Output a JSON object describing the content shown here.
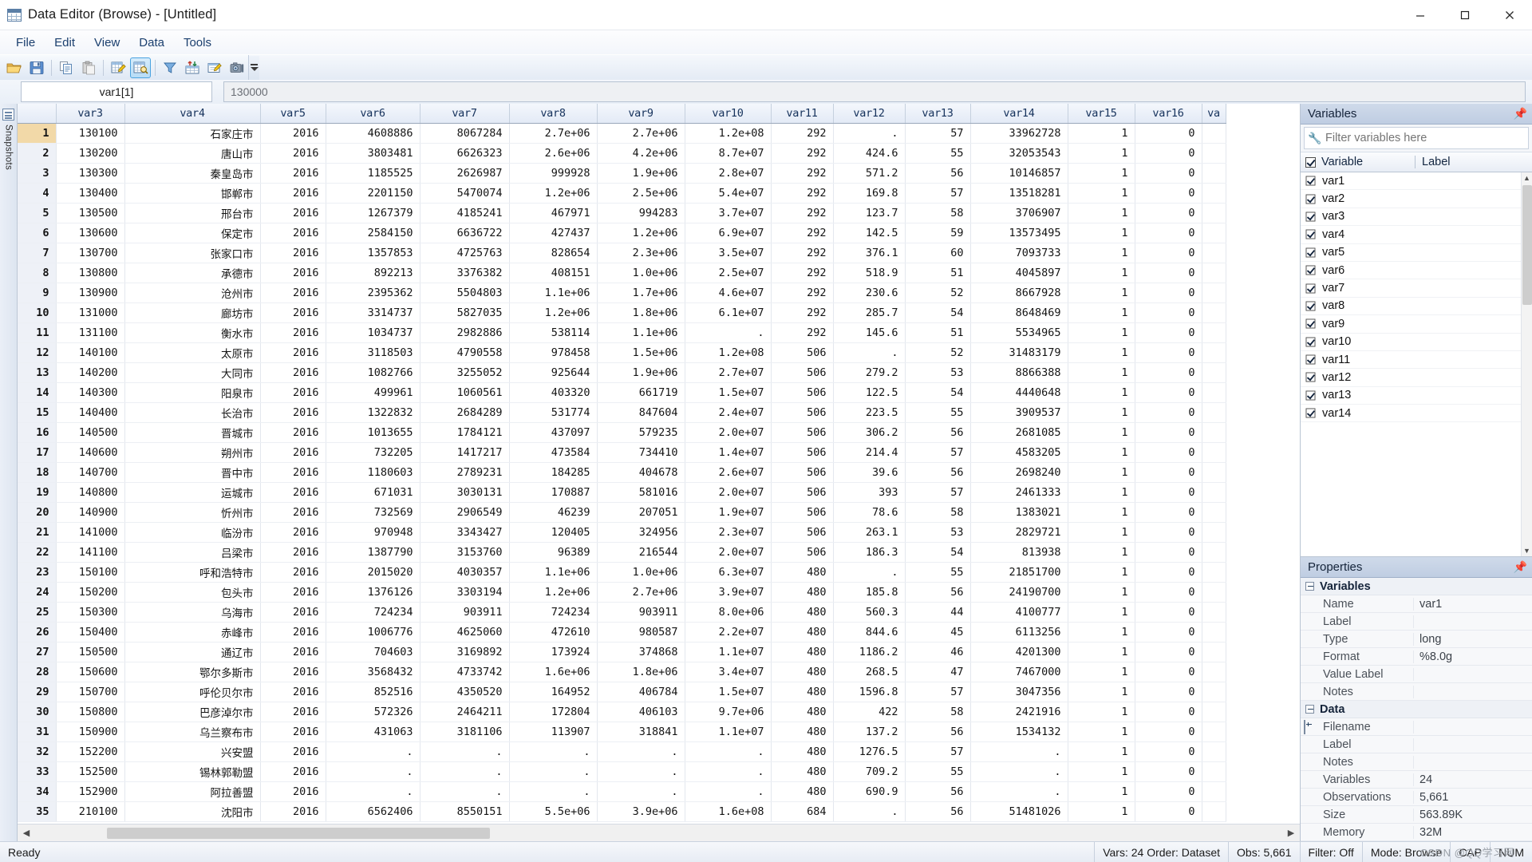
{
  "window": {
    "title": "Data Editor (Browse) - [Untitled]",
    "app_icon": "grid-icon",
    "minimize": "–",
    "maximize": "❐",
    "close": "✕"
  },
  "menubar": {
    "items": [
      "File",
      "Edit",
      "View",
      "Data",
      "Tools"
    ]
  },
  "toolbar": {
    "buttons": [
      {
        "name": "open-file-button",
        "icon": "folder-open-icon",
        "active": false
      },
      {
        "name": "save-button",
        "icon": "floppy-disk-icon",
        "active": false
      },
      {
        "name": "copy-button",
        "icon": "copy-icon",
        "active": false
      },
      {
        "name": "paste-button",
        "icon": "paste-icon",
        "active": false
      },
      {
        "name": "data-edit-button",
        "icon": "pencil-grid-icon",
        "active": false
      },
      {
        "name": "data-browse-button",
        "icon": "magnifier-grid-icon",
        "active": true
      },
      {
        "name": "filter-button",
        "icon": "funnel-icon",
        "active": false
      },
      {
        "name": "variables-manager-button",
        "icon": "arrows-grid-icon",
        "active": false
      },
      {
        "name": "variables-properties-button",
        "icon": "properties-icon",
        "active": false
      },
      {
        "name": "snapshot-button",
        "icon": "camera-icon",
        "active": false
      }
    ],
    "overflow_label": "▼"
  },
  "formula_bar": {
    "cell_reference": "var1[1]",
    "cell_value": "130000"
  },
  "snapshots_rail": {
    "label": "Snapshots",
    "icon": "snapshot-panel-icon"
  },
  "grid": {
    "columns": [
      "var3",
      "var4",
      "var5",
      "var6",
      "var7",
      "var8",
      "var9",
      "var10",
      "var11",
      "var12",
      "var13",
      "var14",
      "var15",
      "var16",
      "va"
    ],
    "selected_row": 1,
    "rows": [
      {
        "n": 1,
        "c": [
          "130100",
          "石家庄市",
          "2016",
          "4608886",
          "8067284",
          "2.7e+06",
          "2.7e+06",
          "1.2e+08",
          "292",
          ".",
          "57",
          "33962728",
          "1",
          "0",
          ""
        ]
      },
      {
        "n": 2,
        "c": [
          "130200",
          "唐山市",
          "2016",
          "3803481",
          "6626323",
          "2.6e+06",
          "4.2e+06",
          "8.7e+07",
          "292",
          "424.6",
          "55",
          "32053543",
          "1",
          "0",
          ""
        ]
      },
      {
        "n": 3,
        "c": [
          "130300",
          "秦皇岛市",
          "2016",
          "1185525",
          "2626987",
          "999928",
          "1.9e+06",
          "2.8e+07",
          "292",
          "571.2",
          "56",
          "10146857",
          "1",
          "0",
          ""
        ]
      },
      {
        "n": 4,
        "c": [
          "130400",
          "邯郸市",
          "2016",
          "2201150",
          "5470074",
          "1.2e+06",
          "2.5e+06",
          "5.4e+07",
          "292",
          "169.8",
          "57",
          "13518281",
          "1",
          "0",
          ""
        ]
      },
      {
        "n": 5,
        "c": [
          "130500",
          "邢台市",
          "2016",
          "1267379",
          "4185241",
          "467971",
          "994283",
          "3.7e+07",
          "292",
          "123.7",
          "58",
          "3706907",
          "1",
          "0",
          ""
        ]
      },
      {
        "n": 6,
        "c": [
          "130600",
          "保定市",
          "2016",
          "2584150",
          "6636722",
          "427437",
          "1.2e+06",
          "6.9e+07",
          "292",
          "142.5",
          "59",
          "13573495",
          "1",
          "0",
          ""
        ]
      },
      {
        "n": 7,
        "c": [
          "130700",
          "张家口市",
          "2016",
          "1357853",
          "4725763",
          "828654",
          "2.3e+06",
          "3.5e+07",
          "292",
          "376.1",
          "60",
          "7093733",
          "1",
          "0",
          ""
        ]
      },
      {
        "n": 8,
        "c": [
          "130800",
          "承德市",
          "2016",
          "892213",
          "3376382",
          "408151",
          "1.0e+06",
          "2.5e+07",
          "292",
          "518.9",
          "51",
          "4045897",
          "1",
          "0",
          ""
        ]
      },
      {
        "n": 9,
        "c": [
          "130900",
          "沧州市",
          "2016",
          "2395362",
          "5504803",
          "1.1e+06",
          "1.7e+06",
          "4.6e+07",
          "292",
          "230.6",
          "52",
          "8667928",
          "1",
          "0",
          ""
        ]
      },
      {
        "n": 10,
        "c": [
          "131000",
          "廊坊市",
          "2016",
          "3314737",
          "5827035",
          "1.2e+06",
          "1.8e+06",
          "6.1e+07",
          "292",
          "285.7",
          "54",
          "8648469",
          "1",
          "0",
          ""
        ]
      },
      {
        "n": 11,
        "c": [
          "131100",
          "衡水市",
          "2016",
          "1034737",
          "2982886",
          "538114",
          "1.1e+06",
          ".",
          "292",
          "145.6",
          "51",
          "5534965",
          "1",
          "0",
          ""
        ]
      },
      {
        "n": 12,
        "c": [
          "140100",
          "太原市",
          "2016",
          "3118503",
          "4790558",
          "978458",
          "1.5e+06",
          "1.2e+08",
          "506",
          ".",
          "52",
          "31483179",
          "1",
          "0",
          ""
        ]
      },
      {
        "n": 13,
        "c": [
          "140200",
          "大同市",
          "2016",
          "1082766",
          "3255052",
          "925644",
          "1.9e+06",
          "2.7e+07",
          "506",
          "279.2",
          "53",
          "8866388",
          "1",
          "0",
          ""
        ]
      },
      {
        "n": 14,
        "c": [
          "140300",
          "阳泉市",
          "2016",
          "499961",
          "1060561",
          "403320",
          "661719",
          "1.5e+07",
          "506",
          "122.5",
          "54",
          "4440648",
          "1",
          "0",
          ""
        ]
      },
      {
        "n": 15,
        "c": [
          "140400",
          "长治市",
          "2016",
          "1322832",
          "2684289",
          "531774",
          "847604",
          "2.4e+07",
          "506",
          "223.5",
          "55",
          "3909537",
          "1",
          "0",
          ""
        ]
      },
      {
        "n": 16,
        "c": [
          "140500",
          "晋城市",
          "2016",
          "1013655",
          "1784121",
          "437097",
          "579235",
          "2.0e+07",
          "506",
          "306.2",
          "56",
          "2681085",
          "1",
          "0",
          ""
        ]
      },
      {
        "n": 17,
        "c": [
          "140600",
          "朔州市",
          "2016",
          "732205",
          "1417217",
          "473584",
          "734410",
          "1.4e+07",
          "506",
          "214.4",
          "57",
          "4583205",
          "1",
          "0",
          ""
        ]
      },
      {
        "n": 18,
        "c": [
          "140700",
          "晋中市",
          "2016",
          "1180603",
          "2789231",
          "184285",
          "404678",
          "2.6e+07",
          "506",
          "39.6",
          "56",
          "2698240",
          "1",
          "0",
          ""
        ]
      },
      {
        "n": 19,
        "c": [
          "140800",
          "运城市",
          "2016",
          "671031",
          "3030131",
          "170887",
          "581016",
          "2.0e+07",
          "506",
          "393",
          "57",
          "2461333",
          "1",
          "0",
          ""
        ]
      },
      {
        "n": 20,
        "c": [
          "140900",
          "忻州市",
          "2016",
          "732569",
          "2906549",
          "46239",
          "207051",
          "1.9e+07",
          "506",
          "78.6",
          "58",
          "1383021",
          "1",
          "0",
          ""
        ]
      },
      {
        "n": 21,
        "c": [
          "141000",
          "临汾市",
          "2016",
          "970948",
          "3343427",
          "120405",
          "324956",
          "2.3e+07",
          "506",
          "263.1",
          "53",
          "2829721",
          "1",
          "0",
          ""
        ]
      },
      {
        "n": 22,
        "c": [
          "141100",
          "吕梁市",
          "2016",
          "1387790",
          "3153760",
          "96389",
          "216544",
          "2.0e+07",
          "506",
          "186.3",
          "54",
          "813938",
          "1",
          "0",
          ""
        ]
      },
      {
        "n": 23,
        "c": [
          "150100",
          "呼和浩特市",
          "2016",
          "2015020",
          "4030357",
          "1.1e+06",
          "1.0e+06",
          "6.3e+07",
          "480",
          ".",
          "55",
          "21851700",
          "1",
          "0",
          ""
        ]
      },
      {
        "n": 24,
        "c": [
          "150200",
          "包头市",
          "2016",
          "1376126",
          "3303194",
          "1.2e+06",
          "2.7e+06",
          "3.9e+07",
          "480",
          "185.8",
          "56",
          "24190700",
          "1",
          "0",
          ""
        ]
      },
      {
        "n": 25,
        "c": [
          "150300",
          "乌海市",
          "2016",
          "724234",
          "903911",
          "724234",
          "903911",
          "8.0e+06",
          "480",
          "560.3",
          "44",
          "4100777",
          "1",
          "0",
          ""
        ]
      },
      {
        "n": 26,
        "c": [
          "150400",
          "赤峰市",
          "2016",
          "1006776",
          "4625060",
          "472610",
          "980587",
          "2.2e+07",
          "480",
          "844.6",
          "45",
          "6113256",
          "1",
          "0",
          ""
        ]
      },
      {
        "n": 27,
        "c": [
          "150500",
          "通辽市",
          "2016",
          "704603",
          "3169892",
          "173924",
          "374868",
          "1.1e+07",
          "480",
          "1186.2",
          "46",
          "4201300",
          "1",
          "0",
          ""
        ]
      },
      {
        "n": 28,
        "c": [
          "150600",
          "鄂尔多斯市",
          "2016",
          "3568432",
          "4733742",
          "1.6e+06",
          "1.8e+06",
          "3.4e+07",
          "480",
          "268.5",
          "47",
          "7467000",
          "1",
          "0",
          ""
        ]
      },
      {
        "n": 29,
        "c": [
          "150700",
          "呼伦贝尔市",
          "2016",
          "852516",
          "4350520",
          "164952",
          "406784",
          "1.5e+07",
          "480",
          "1596.8",
          "57",
          "3047356",
          "1",
          "0",
          ""
        ]
      },
      {
        "n": 30,
        "c": [
          "150800",
          "巴彦淖尔市",
          "2016",
          "572326",
          "2464211",
          "172804",
          "406103",
          "9.7e+06",
          "480",
          "422",
          "58",
          "2421916",
          "1",
          "0",
          ""
        ]
      },
      {
        "n": 31,
        "c": [
          "150900",
          "乌兰察布市",
          "2016",
          "431063",
          "3181106",
          "113907",
          "318841",
          "1.1e+07",
          "480",
          "137.2",
          "56",
          "1534132",
          "1",
          "0",
          ""
        ]
      },
      {
        "n": 32,
        "c": [
          "152200",
          "兴安盟",
          "2016",
          ".",
          ".",
          ".",
          ".",
          ".",
          "480",
          "1276.5",
          "57",
          ".",
          "1",
          "0",
          ""
        ]
      },
      {
        "n": 33,
        "c": [
          "152500",
          "锡林郭勒盟",
          "2016",
          ".",
          ".",
          ".",
          ".",
          ".",
          "480",
          "709.2",
          "55",
          ".",
          "1",
          "0",
          ""
        ]
      },
      {
        "n": 34,
        "c": [
          "152900",
          "阿拉善盟",
          "2016",
          ".",
          ".",
          ".",
          ".",
          ".",
          "480",
          "690.9",
          "56",
          ".",
          "1",
          "0",
          ""
        ]
      },
      {
        "n": 35,
        "c": [
          "210100",
          "沈阳市",
          "2016",
          "6562406",
          "8550151",
          "5.5e+06",
          "3.9e+06",
          "1.6e+08",
          "684",
          ".",
          "56",
          "51481026",
          "1",
          "0",
          ""
        ]
      }
    ]
  },
  "variables_pane": {
    "title": "Variables",
    "pin_icon": "pin-icon",
    "filter_placeholder": "Filter variables here",
    "filter_value": "",
    "wrench_icon": "wrench-icon",
    "columns": [
      "Variable",
      "Label"
    ],
    "select_all_checked": true,
    "items": [
      {
        "name": "var1",
        "label": "",
        "checked": true
      },
      {
        "name": "var2",
        "label": "",
        "checked": true
      },
      {
        "name": "var3",
        "label": "",
        "checked": true
      },
      {
        "name": "var4",
        "label": "",
        "checked": true
      },
      {
        "name": "var5",
        "label": "",
        "checked": true
      },
      {
        "name": "var6",
        "label": "",
        "checked": true
      },
      {
        "name": "var7",
        "label": "",
        "checked": true
      },
      {
        "name": "var8",
        "label": "",
        "checked": true
      },
      {
        "name": "var9",
        "label": "",
        "checked": true
      },
      {
        "name": "var10",
        "label": "",
        "checked": true
      },
      {
        "name": "var11",
        "label": "",
        "checked": true
      },
      {
        "name": "var12",
        "label": "",
        "checked": true
      },
      {
        "name": "var13",
        "label": "",
        "checked": true
      },
      {
        "name": "var14",
        "label": "",
        "checked": true
      }
    ]
  },
  "properties_pane": {
    "title": "Properties",
    "pin_icon": "pin-icon",
    "groups": [
      {
        "name": "Variables",
        "expander": "minus",
        "rows": [
          {
            "key": "Name",
            "value": "var1",
            "expander": ""
          },
          {
            "key": "Label",
            "value": "",
            "expander": ""
          },
          {
            "key": "Type",
            "value": "long",
            "expander": ""
          },
          {
            "key": "Format",
            "value": "%8.0g",
            "expander": ""
          },
          {
            "key": "Value Label",
            "value": "",
            "expander": ""
          },
          {
            "key": "Notes",
            "value": "",
            "expander": ""
          }
        ]
      },
      {
        "name": "Data",
        "expander": "minus",
        "rows": [
          {
            "key": "Filename",
            "value": "",
            "expander": "plus"
          },
          {
            "key": "Label",
            "value": "",
            "expander": ""
          },
          {
            "key": "Notes",
            "value": "",
            "expander": ""
          },
          {
            "key": "Variables",
            "value": "24",
            "expander": ""
          },
          {
            "key": "Observations",
            "value": "5,661",
            "expander": ""
          },
          {
            "key": "Size",
            "value": "563.89K",
            "expander": ""
          },
          {
            "key": "Memory",
            "value": "32M",
            "expander": ""
          }
        ]
      }
    ]
  },
  "statusbar": {
    "message": "Ready",
    "cells": [
      "Vars: 24  Order: Dataset",
      "Obs: 5,661",
      "Filter: Off",
      "Mode: Browse",
      "CAP",
      "NUM"
    ]
  },
  "watermark": "CSDN @QQ学习网",
  "colors": {
    "accent": "#4aa3e0",
    "cjk_text": "#c00000",
    "header_bg": "#e3eaf6",
    "selected_row": "#f2d9a8",
    "pane_head": "#bfcde2"
  }
}
